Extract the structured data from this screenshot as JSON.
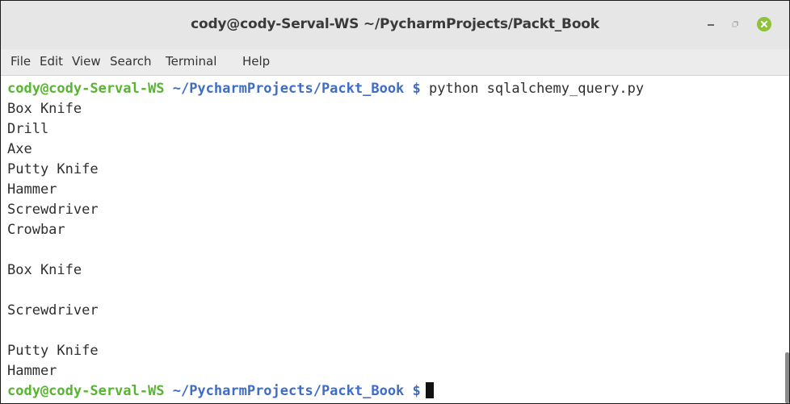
{
  "window": {
    "title": "cody@cody-Serval-WS ~/PycharmProjects/Packt_Book"
  },
  "menu": {
    "file": "File",
    "edit": "Edit",
    "view": "View",
    "search": "Search",
    "terminal": "Terminal",
    "help": "Help"
  },
  "terminal": {
    "prompt_user": "cody@cody-Serval-WS",
    "prompt_path": "~/PycharmProjects/Packt_Book $",
    "command": "python sqlalchemy_query.py",
    "output": [
      "Box Knife",
      "Drill",
      "Axe",
      "Putty Knife",
      "Hammer",
      "Screwdriver",
      "Crowbar",
      "",
      "Box Knife",
      "",
      "Screwdriver",
      "",
      "Putty Knife",
      "Hammer"
    ],
    "final_prompt_user": "cody@cody-Serval-WS",
    "final_prompt_path": "~/PycharmProjects/Packt_Book $"
  },
  "colors": {
    "prompt_user": "#58b531",
    "prompt_path": "#3f6dc5",
    "close_button": "#8fc13a"
  },
  "icons": {
    "minimize": "minimize-icon",
    "maximize": "maximize-icon",
    "close": "close-icon"
  }
}
